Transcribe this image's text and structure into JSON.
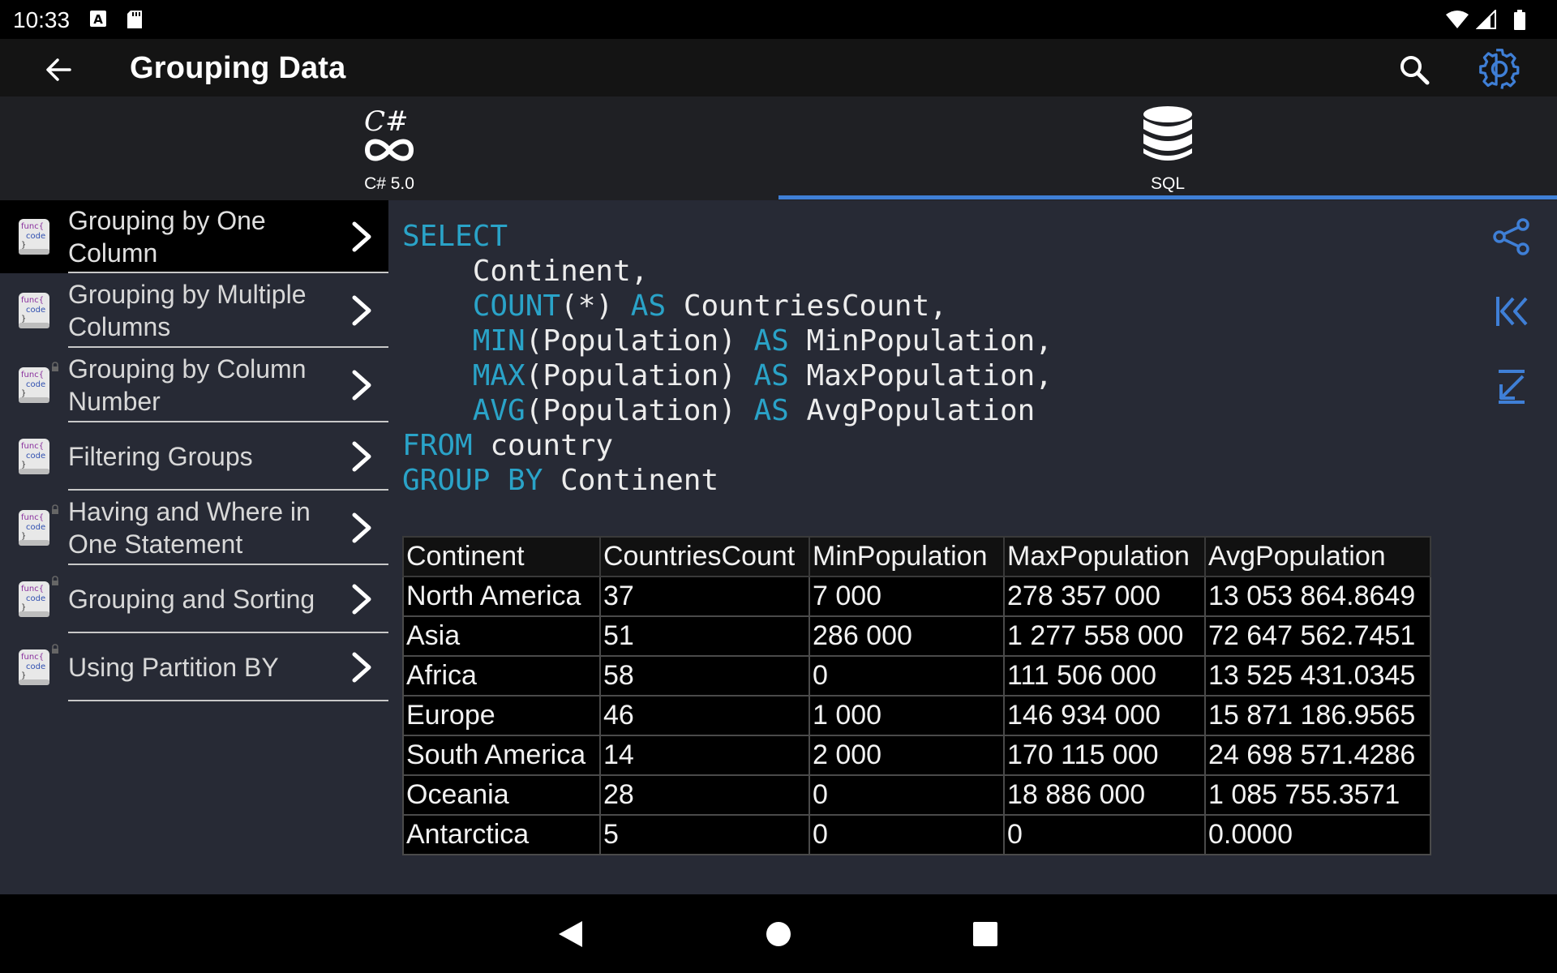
{
  "status_bar": {
    "time": "10:33"
  },
  "app_bar": {
    "title": "Grouping Data"
  },
  "tabs": [
    {
      "label": "C# 5.0",
      "icon": "csharp-icon",
      "selected": false
    },
    {
      "label": "SQL",
      "icon": "database-icon",
      "selected": true
    }
  ],
  "sidebar": {
    "items": [
      {
        "label": "Grouping by One Column",
        "active": true,
        "locked": false
      },
      {
        "label": "Grouping by Multiple Columns",
        "active": false,
        "locked": false
      },
      {
        "label": "Grouping by Column Number",
        "active": false,
        "locked": true
      },
      {
        "label": "Filtering Groups",
        "active": false,
        "locked": false
      },
      {
        "label": "Having and Where in One Statement",
        "active": false,
        "locked": true
      },
      {
        "label": "Grouping and Sorting",
        "active": false,
        "locked": true
      },
      {
        "label": "Using Partition BY",
        "active": false,
        "locked": true
      }
    ],
    "icon_text": {
      "line1": "func{",
      "line2": "code",
      "line3": "}"
    }
  },
  "code": {
    "lines": [
      [
        {
          "t": "SELECT",
          "kw": true
        }
      ],
      [
        {
          "t": "    Continent,",
          "kw": false
        }
      ],
      [
        {
          "t": "    ",
          "kw": false
        },
        {
          "t": "COUNT",
          "kw": true
        },
        {
          "t": "(*) ",
          "kw": false
        },
        {
          "t": "AS",
          "kw": true
        },
        {
          "t": " CountriesCount,",
          "kw": false
        }
      ],
      [
        {
          "t": "    ",
          "kw": false
        },
        {
          "t": "MIN",
          "kw": true
        },
        {
          "t": "(Population) ",
          "kw": false
        },
        {
          "t": "AS",
          "kw": true
        },
        {
          "t": " MinPopulation,",
          "kw": false
        }
      ],
      [
        {
          "t": "    ",
          "kw": false
        },
        {
          "t": "MAX",
          "kw": true
        },
        {
          "t": "(Population) ",
          "kw": false
        },
        {
          "t": "AS",
          "kw": true
        },
        {
          "t": " MaxPopulation,",
          "kw": false
        }
      ],
      [
        {
          "t": "    ",
          "kw": false
        },
        {
          "t": "AVG",
          "kw": true
        },
        {
          "t": "(Population) ",
          "kw": false
        },
        {
          "t": "AS",
          "kw": true
        },
        {
          "t": " AvgPopulation",
          "kw": false
        }
      ],
      [
        {
          "t": "FROM",
          "kw": true
        },
        {
          "t": " country",
          "kw": false
        }
      ],
      [
        {
          "t": "GROUP BY",
          "kw": true
        },
        {
          "t": " Continent",
          "kw": false
        }
      ]
    ]
  },
  "result": {
    "columns": [
      "Continent",
      "CountriesCount",
      "MinPopulation",
      "MaxPopulation",
      "AvgPopulation"
    ],
    "rows": [
      [
        "North America",
        "37",
        "7 000",
        "278 357 000",
        "13 053 864.8649"
      ],
      [
        "Asia",
        "51",
        "286 000",
        "1 277 558 000",
        "72 647 562.7451"
      ],
      [
        "Africa",
        "58",
        "0",
        "111 506 000",
        "13 525 431.0345"
      ],
      [
        "Europe",
        "46",
        "1 000",
        "146 934 000",
        "15 871 186.9565"
      ],
      [
        "South America",
        "14",
        "2 000",
        "170 115 000",
        "24 698 571.4286"
      ],
      [
        "Oceania",
        "28",
        "0",
        "18 886 000",
        "1 085 755.3571"
      ],
      [
        "Antarctica",
        "5",
        "0",
        "0",
        "0.0000"
      ]
    ]
  },
  "actions": [
    {
      "icon": "share-icon"
    },
    {
      "icon": "jump-to-start-icon"
    },
    {
      "icon": "collapse-arrow-icon"
    }
  ],
  "colors": {
    "accent": "#3f7fd6",
    "keyword": "#2aa3c8",
    "background": "#272a35"
  }
}
